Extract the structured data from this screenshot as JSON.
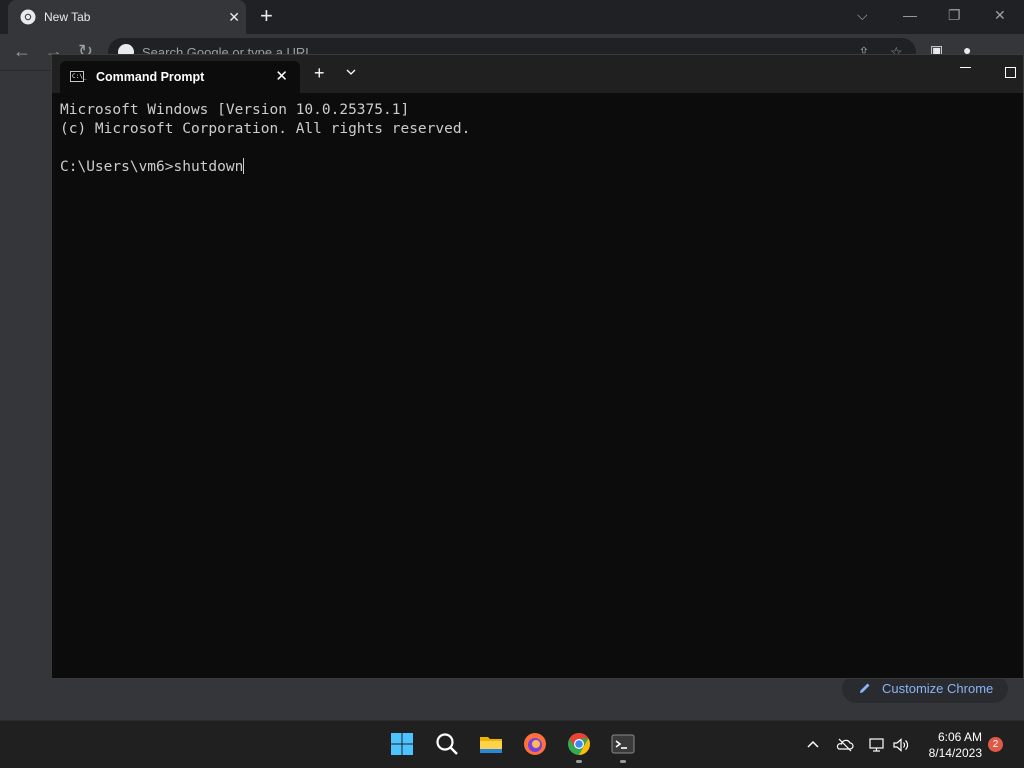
{
  "chrome": {
    "tab_title": "New Tab",
    "omnibox_placeholder": "Search Google or type a URL",
    "customize_label": "Customize Chrome"
  },
  "terminal": {
    "tab_title": "Command Prompt",
    "cmd_icon_text": "C:\\_",
    "lines": [
      "Microsoft Windows [Version 10.0.25375.1]",
      "(c) Microsoft Corporation. All rights reserved.",
      "",
      "C:\\Users\\vm6>shutdown"
    ]
  },
  "taskbar": {
    "apps": [
      "start-icon",
      "search-icon",
      "file-explorer-icon",
      "firefox-icon",
      "chrome-icon",
      "terminal-icon"
    ],
    "time": "6:06 AM",
    "date": "8/14/2023",
    "notification_count": "2"
  },
  "colors": {
    "chrome_bg": "#35363a",
    "terminal_bg": "#0c0c0c",
    "taskbar_bg": "#202020",
    "accent_link": "#8ab4f8",
    "badge": "#e05a47"
  }
}
